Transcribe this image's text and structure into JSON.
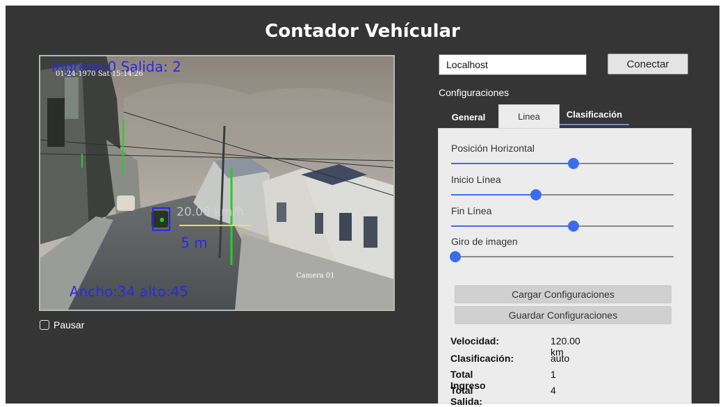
{
  "app": {
    "title": "Contador Vehícular"
  },
  "video": {
    "timestamp": "01-24-1970 Sat 15:14:26",
    "overlay_counts": "Ingreso:0 Salida: 2",
    "speed_overlay": "20.00 km/h",
    "distance_overlay": "5 m",
    "size_overlay": "Ancho:34 alto:45",
    "camera_label": "Camera 01",
    "colors": {
      "overlay_text": "#2a2ae0",
      "guide_line": "#23d023",
      "crosshair": "#e6e64a",
      "box": "#1f2be6"
    }
  },
  "pause": {
    "label": "Pausar",
    "checked": false
  },
  "connection": {
    "host_value": "Localhost",
    "connect_label": "Conectar"
  },
  "config": {
    "title": "Configuraciones",
    "tabs": [
      {
        "label": "General",
        "active": false
      },
      {
        "label": "Linea",
        "active": true
      },
      {
        "label": "Clasificación",
        "active": false
      }
    ],
    "sliders": [
      {
        "label": "Posición Horizontal",
        "value": 0.55
      },
      {
        "label": "Inicio Línea",
        "value": 0.38
      },
      {
        "label": "Fin Línea",
        "value": 0.55
      },
      {
        "label": "Giro de imagen",
        "value": 0.02
      }
    ],
    "load_label": "Cargar Configuraciones",
    "save_label": "Guardar Configuraciones",
    "stats": [
      {
        "label": "Velocidad:",
        "value": "120.00 km"
      },
      {
        "label": "Clasificación:",
        "value": "auto"
      },
      {
        "label": "Total Ingreso",
        "value": "1"
      },
      {
        "label": "Total Salida:",
        "value": "4"
      }
    ],
    "accent_color": "#3a6ee8"
  }
}
